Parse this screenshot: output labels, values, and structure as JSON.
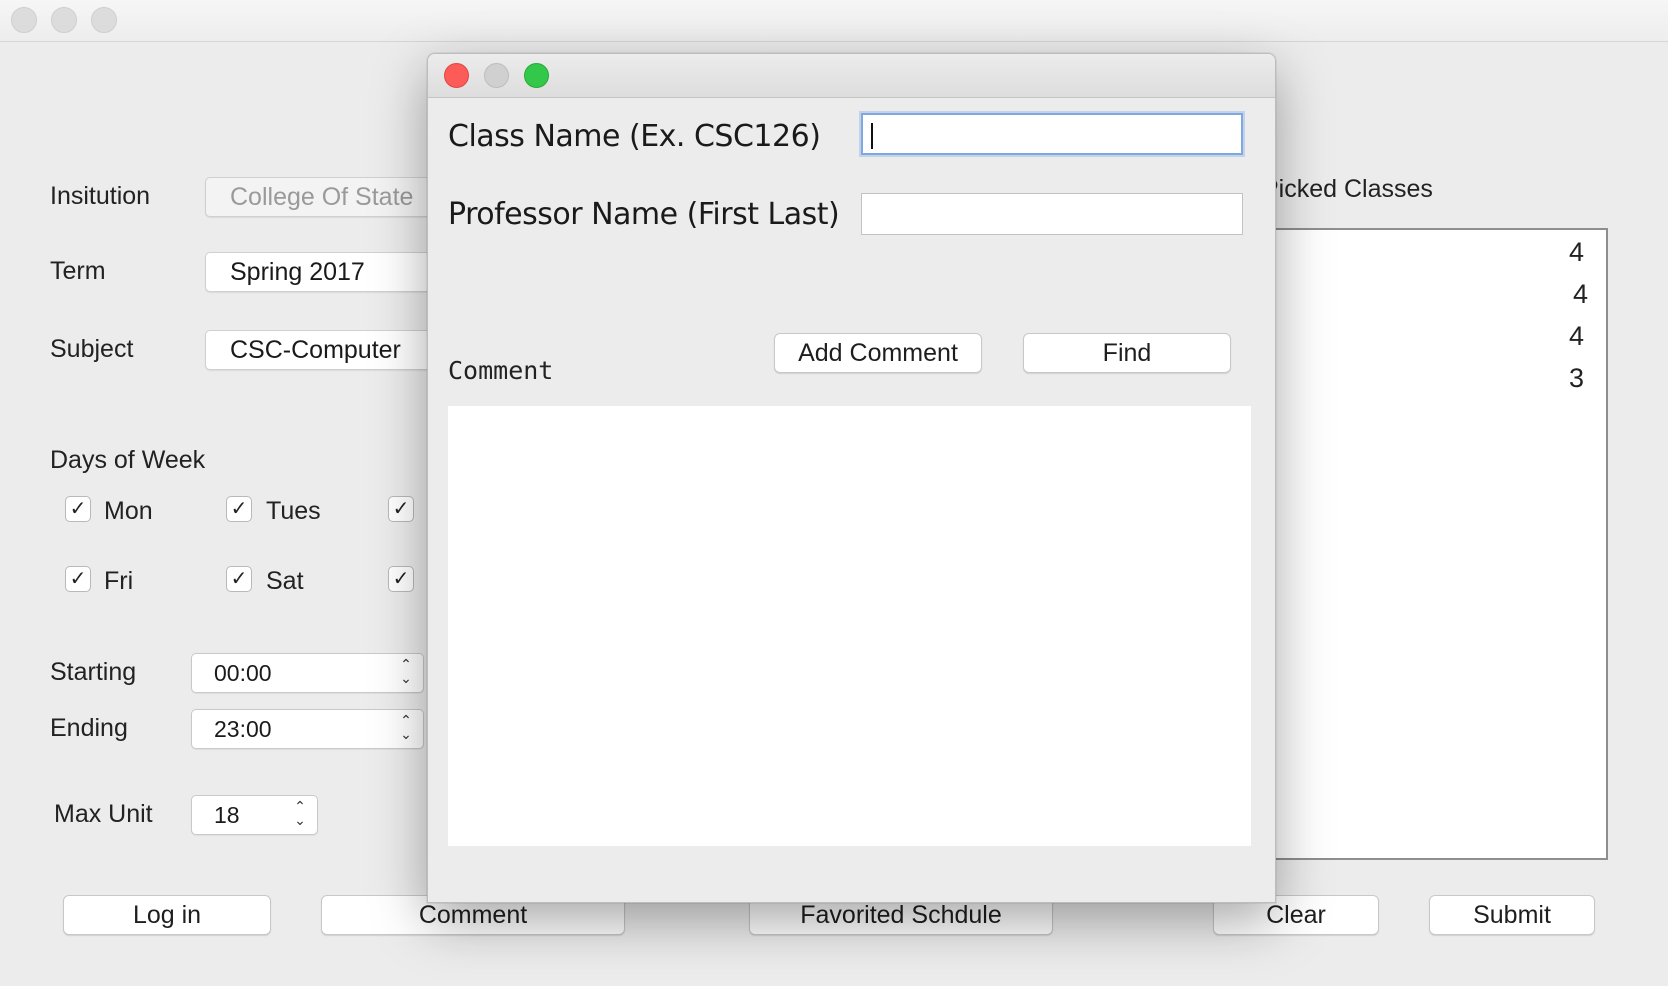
{
  "main": {
    "labels": {
      "institution": "Insitution",
      "term": "Term",
      "subject": "Subject",
      "days_of_week": "Days of Week",
      "starting": "Starting",
      "ending": "Ending",
      "max_unit": "Max Unit",
      "picked_classes": "Picked Classes"
    },
    "institution_value": "College Of State",
    "term_value": "Spring 2017",
    "subject_value": "CSC-Computer",
    "days": {
      "mon": {
        "label": "Mon",
        "checked": "✓"
      },
      "tues": {
        "label": "Tues",
        "checked": "✓"
      },
      "wed": {
        "label": "",
        "checked": "✓"
      },
      "fri": {
        "label": "Fri",
        "checked": "✓"
      },
      "sat": {
        "label": "Sat",
        "checked": "✓"
      },
      "sun": {
        "label": "",
        "checked": "✓"
      }
    },
    "starting_value": "00:00",
    "ending_value": "23:00",
    "max_unit_value": "18",
    "picked_units": [
      "4",
      "4",
      "4",
      "3"
    ],
    "buttons": {
      "login": "Log in",
      "comment": "Comment",
      "favorited": "Favorited Schdule",
      "clear": "Clear",
      "submit": "Submit"
    }
  },
  "dialog": {
    "class_name_label": "Class Name (Ex. CSC126)",
    "class_name_value": "",
    "professor_label": "Professor Name (First Last)",
    "professor_value": "",
    "comment_label": "Comment",
    "add_comment_button": "Add Comment",
    "find_button": "Find",
    "comment_text": ""
  },
  "icons": {
    "checkmark": "check-icon",
    "spinner": "up-down-arrows-icon"
  },
  "colors": {
    "close": "#fc5b57",
    "maximize": "#34c84a",
    "focus_ring": "#7fa8e0"
  }
}
